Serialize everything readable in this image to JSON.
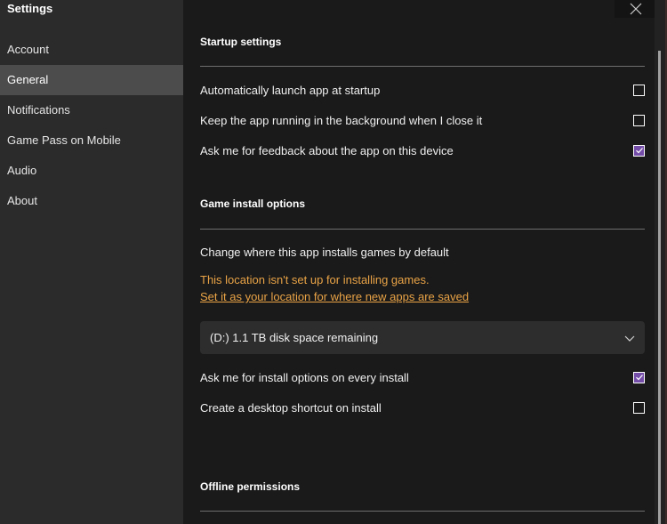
{
  "sidebar": {
    "title": "Settings",
    "items": [
      {
        "label": "Account",
        "active": false
      },
      {
        "label": "General",
        "active": true
      },
      {
        "label": "Notifications",
        "active": false
      },
      {
        "label": "Game Pass on Mobile",
        "active": false
      },
      {
        "label": "Audio",
        "active": false
      },
      {
        "label": "About",
        "active": false
      }
    ]
  },
  "window": {
    "close_icon": "close-icon"
  },
  "startup": {
    "title": "Startup settings",
    "options": [
      {
        "label": "Automatically launch app at startup",
        "checked": false
      },
      {
        "label": "Keep the app running in the background when I close it",
        "checked": false
      },
      {
        "label": "Ask me for feedback about the app on this device",
        "checked": true
      }
    ]
  },
  "install": {
    "title": "Game install options",
    "location_label": "Change where this app installs games by default",
    "warning": "This location isn't set up for installing games.",
    "warning_link": "Set it as your location for where new apps are saved",
    "drive_selected": "(D:) 1.1 TB disk space remaining",
    "options": [
      {
        "label": "Ask me for install options on every install",
        "checked": true
      },
      {
        "label": "Create a desktop shortcut on install",
        "checked": false
      }
    ]
  },
  "offline": {
    "title": "Offline permissions"
  },
  "colors": {
    "accent": "#744da9",
    "warning": "#e9a346",
    "sidebar_bg": "#2b2b2b",
    "sidebar_active": "#4c4c4c",
    "main_bg": "#1a1a1a"
  }
}
